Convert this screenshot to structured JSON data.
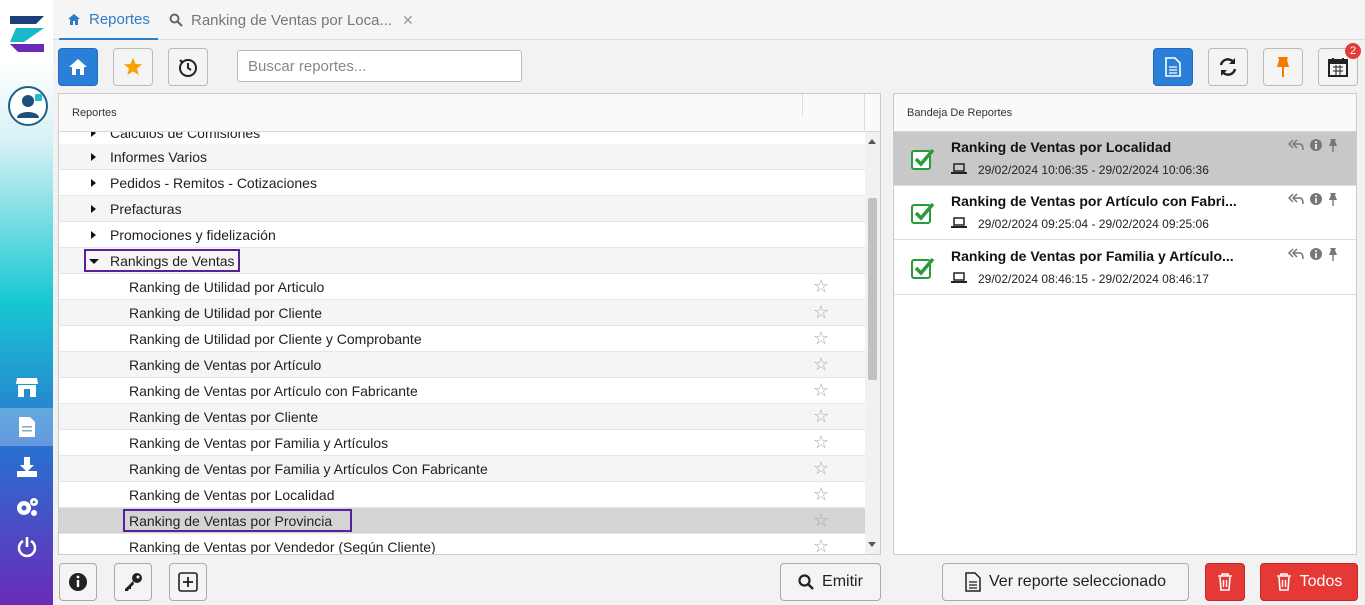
{
  "tabs": [
    {
      "label": "Reportes"
    },
    {
      "label": "Ranking de Ventas por Loca..."
    }
  ],
  "toolbar": {
    "search_placeholder": "Buscar reportes...",
    "calendar_badge": "2"
  },
  "left_panel": {
    "header": "Reportes",
    "rows": [
      {
        "label": "Calculos de Comisiones",
        "type": "folder"
      },
      {
        "label": "Informes Varios",
        "type": "folder"
      },
      {
        "label": "Pedidos - Remitos - Cotizaciones",
        "type": "folder"
      },
      {
        "label": "Prefacturas",
        "type": "folder"
      },
      {
        "label": "Promociones y fidelización",
        "type": "folder"
      },
      {
        "label": "Rankings de Ventas",
        "type": "folder-open"
      },
      {
        "label": "Ranking de Utilidad por Articulo",
        "type": "report"
      },
      {
        "label": "Ranking de Utilidad por Cliente",
        "type": "report"
      },
      {
        "label": "Ranking de Utilidad por Cliente y Comprobante",
        "type": "report"
      },
      {
        "label": "Ranking de Ventas por Artículo",
        "type": "report"
      },
      {
        "label": "Ranking de Ventas por Artículo con Fabricante",
        "type": "report"
      },
      {
        "label": "Ranking de Ventas por Cliente",
        "type": "report"
      },
      {
        "label": "Ranking de Ventas por Familia y Artículos",
        "type": "report"
      },
      {
        "label": "Ranking de Ventas por Familia y Artículos Con Fabricante",
        "type": "report"
      },
      {
        "label": "Ranking de Ventas por Localidad",
        "type": "report"
      },
      {
        "label": "Ranking de Ventas por Provincia",
        "type": "report",
        "selected": true
      },
      {
        "label": "Ranking de Ventas por Vendedor (Según Cliente)",
        "type": "report"
      }
    ]
  },
  "right_panel": {
    "header": "Bandeja De Reportes",
    "items": [
      {
        "title": "Ranking de Ventas por Localidad",
        "dates": "29/02/2024 10:06:35 - 29/02/2024 10:06:36",
        "selected": true
      },
      {
        "title": "Ranking de Ventas por Artículo con Fabri...",
        "dates": "29/02/2024 09:25:04 - 29/02/2024 09:25:06"
      },
      {
        "title": "Ranking de Ventas por Familia y Artículo...",
        "dates": "29/02/2024 08:46:15 - 29/02/2024 08:46:17"
      }
    ]
  },
  "bottom": {
    "emitir": "Emitir",
    "ver_reporte": "Ver reporte seleccionado",
    "todos": "Todos"
  }
}
